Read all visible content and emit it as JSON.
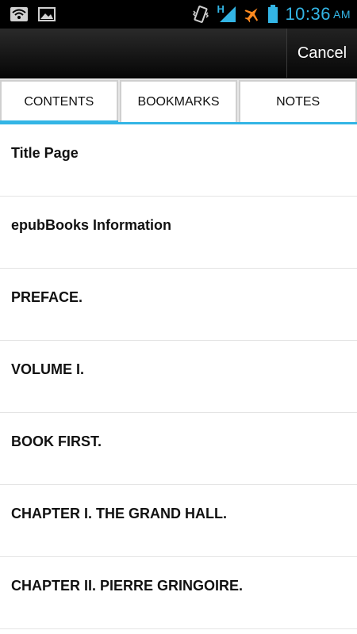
{
  "status_bar": {
    "icons_left": [
      "wifi-icon",
      "image-notification-icon"
    ],
    "icons_right": [
      "vibrate-icon",
      "hspa-signal-icon",
      "airplane-icon",
      "battery-icon"
    ],
    "signal_label": "H",
    "time": "10:36",
    "ampm": "AM",
    "accent_color": "#33b5e5"
  },
  "action_bar": {
    "cancel_label": "Cancel"
  },
  "tabs": [
    {
      "label": "CONTENTS",
      "active": true
    },
    {
      "label": "BOOKMARKS",
      "active": false
    },
    {
      "label": "NOTES",
      "active": false
    }
  ],
  "toc": [
    {
      "label": "Title Page"
    },
    {
      "label": "epubBooks Information"
    },
    {
      "label": "PREFACE."
    },
    {
      "label": "VOLUME I."
    },
    {
      "label": "BOOK FIRST."
    },
    {
      "label": "CHAPTER I. THE GRAND HALL."
    },
    {
      "label": "CHAPTER II. PIERRE GRINGOIRE."
    }
  ]
}
